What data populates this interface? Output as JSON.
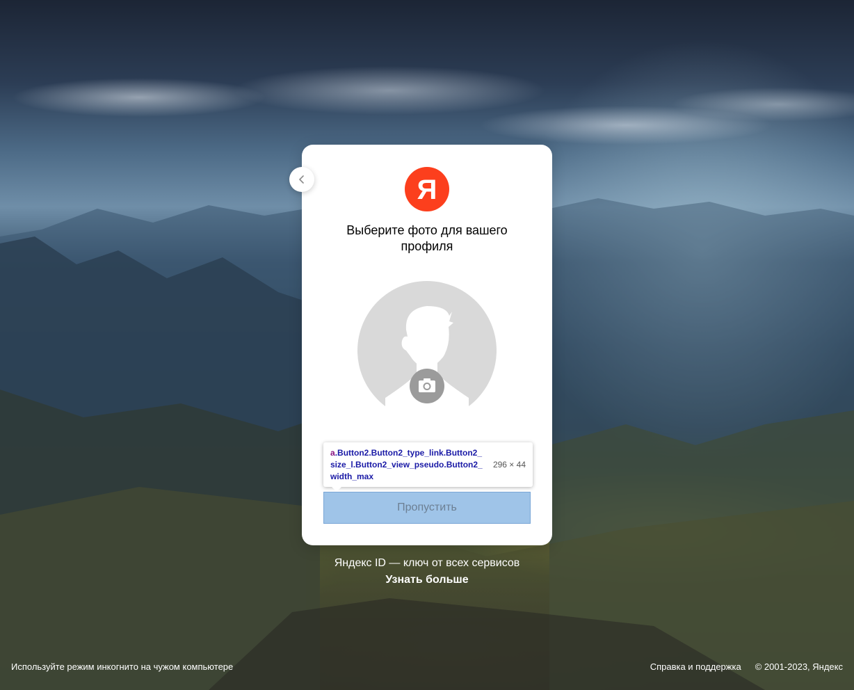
{
  "background": {
    "scene": "mountain-valley-sunrays"
  },
  "back_button": {
    "icon": "chevron-left-icon"
  },
  "logo": {
    "letter": "Я",
    "color": "#fc3f1d"
  },
  "card": {
    "title": "Выберите фото для вашего профиля",
    "avatar_icon": "user-silhouette-icon",
    "camera_icon": "camera-icon",
    "skip_button_label": "Пропустить"
  },
  "devtools_tooltip": {
    "selector_tag": "a",
    "selector_classes": ".Button2.Button2_type_link.Button2_size_l.Button2_view_pseudo.Button2_width_max",
    "size": "296 × 44"
  },
  "promo": {
    "text": "Яндекс ID — ключ от всех сервисов",
    "link": "Узнать больше"
  },
  "footer": {
    "incognito_hint": "Используйте режим инкогнито на чужом компьютере",
    "help_link": "Справка и поддержка",
    "copyright": "© 2001-2023, Яндекс"
  },
  "colors": {
    "accent_red": "#fc3f1d",
    "skip_button_bg": "#9fc4e8",
    "card_bg": "#ffffff"
  }
}
